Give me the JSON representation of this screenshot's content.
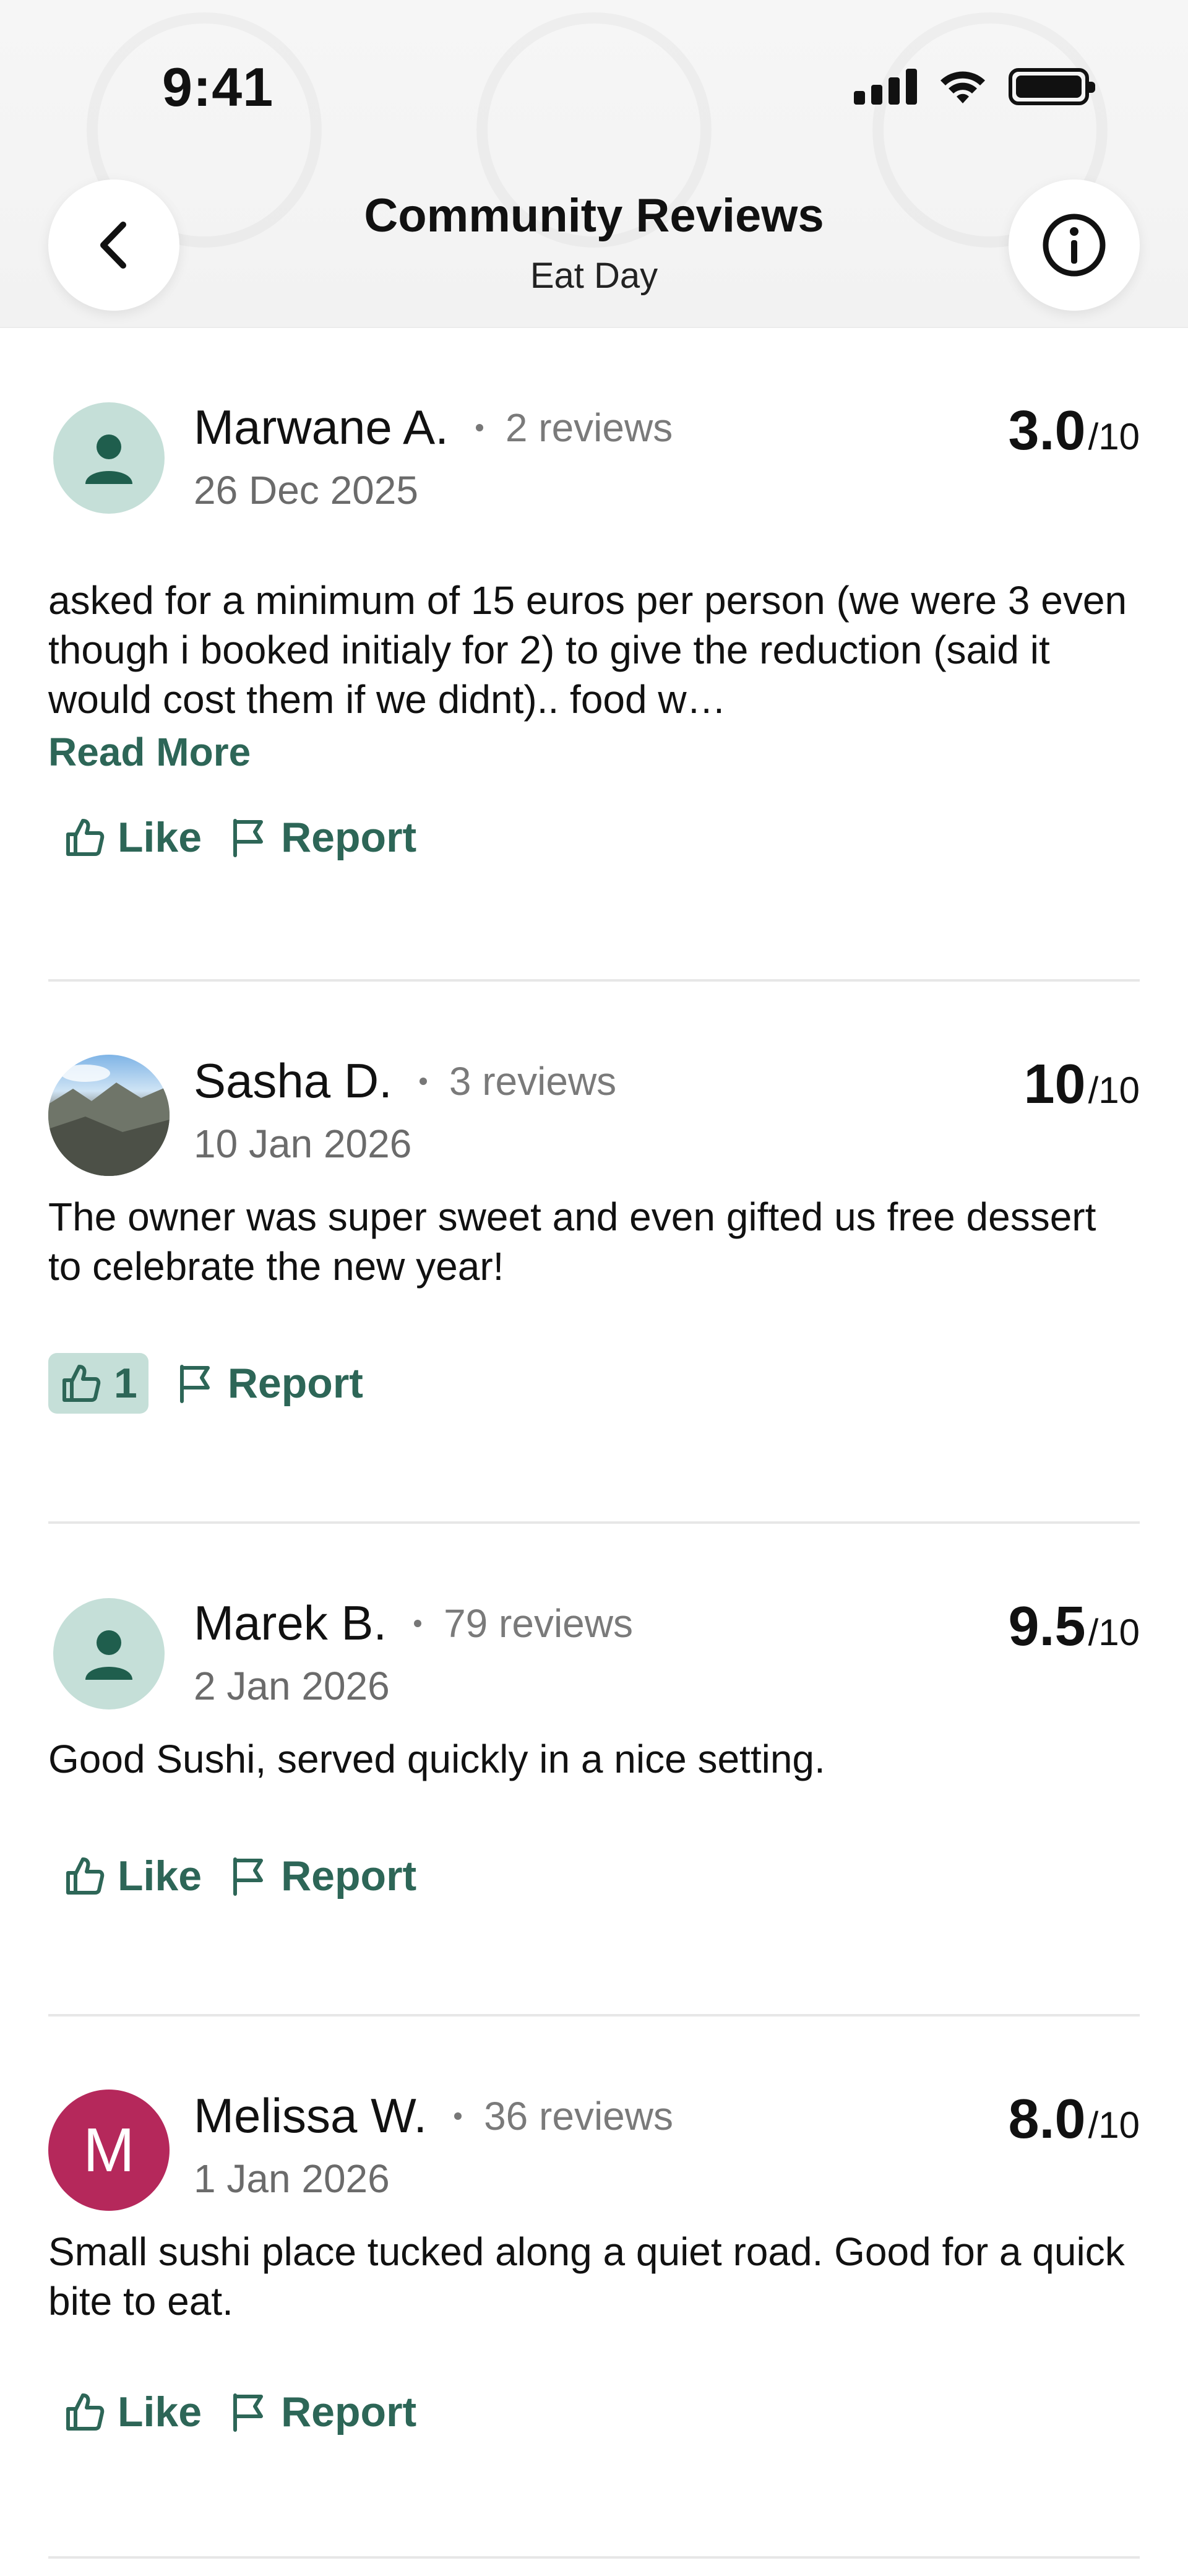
{
  "status_bar": {
    "time": "9:41"
  },
  "header": {
    "title": "Community Reviews",
    "subtitle": "Eat Day",
    "back_icon": "chevron-left-icon",
    "info_icon": "info-icon"
  },
  "actions": {
    "like": "Like",
    "report": "Report",
    "read_more": "Read More"
  },
  "reviews": [
    {
      "name": "Marwane A.",
      "count": "2 reviews",
      "date": "26 Dec 2025",
      "score": "3.0",
      "max": "/10",
      "avatar": "default-person-icon",
      "text": "asked for a minimum of 15 euros per person (we were 3 even though i booked initialy for 2) to give the reduction (said it would cost them if we didnt).. food w…",
      "likes": ""
    },
    {
      "name": "Sasha D.",
      "count": "3 reviews",
      "date": "10 Jan 2026",
      "score": "10",
      "max": "/10",
      "avatar": "photo",
      "text": "The owner was super sweet and even gifted us free dessert to celebrate the new year!",
      "likes": "1"
    },
    {
      "name": "Marek B.",
      "count": "79 reviews",
      "date": "2 Jan 2026",
      "score": "9.5",
      "max": "/10",
      "avatar": "default-person-icon",
      "text": "Good Sushi, served quickly in a nice setting.",
      "likes": ""
    },
    {
      "name": "Melissa W.",
      "count": "36 reviews",
      "date": "1 Jan 2026",
      "score": "8.0",
      "max": "/10",
      "avatar_letter": "M",
      "avatar_color": "#b5285b",
      "text": "Small sushi place tucked along a quiet road.  Good for a quick bite to eat.",
      "likes": ""
    }
  ],
  "colors": {
    "accent": "#2d6657",
    "avatar_bg": "#c5dfd8"
  }
}
